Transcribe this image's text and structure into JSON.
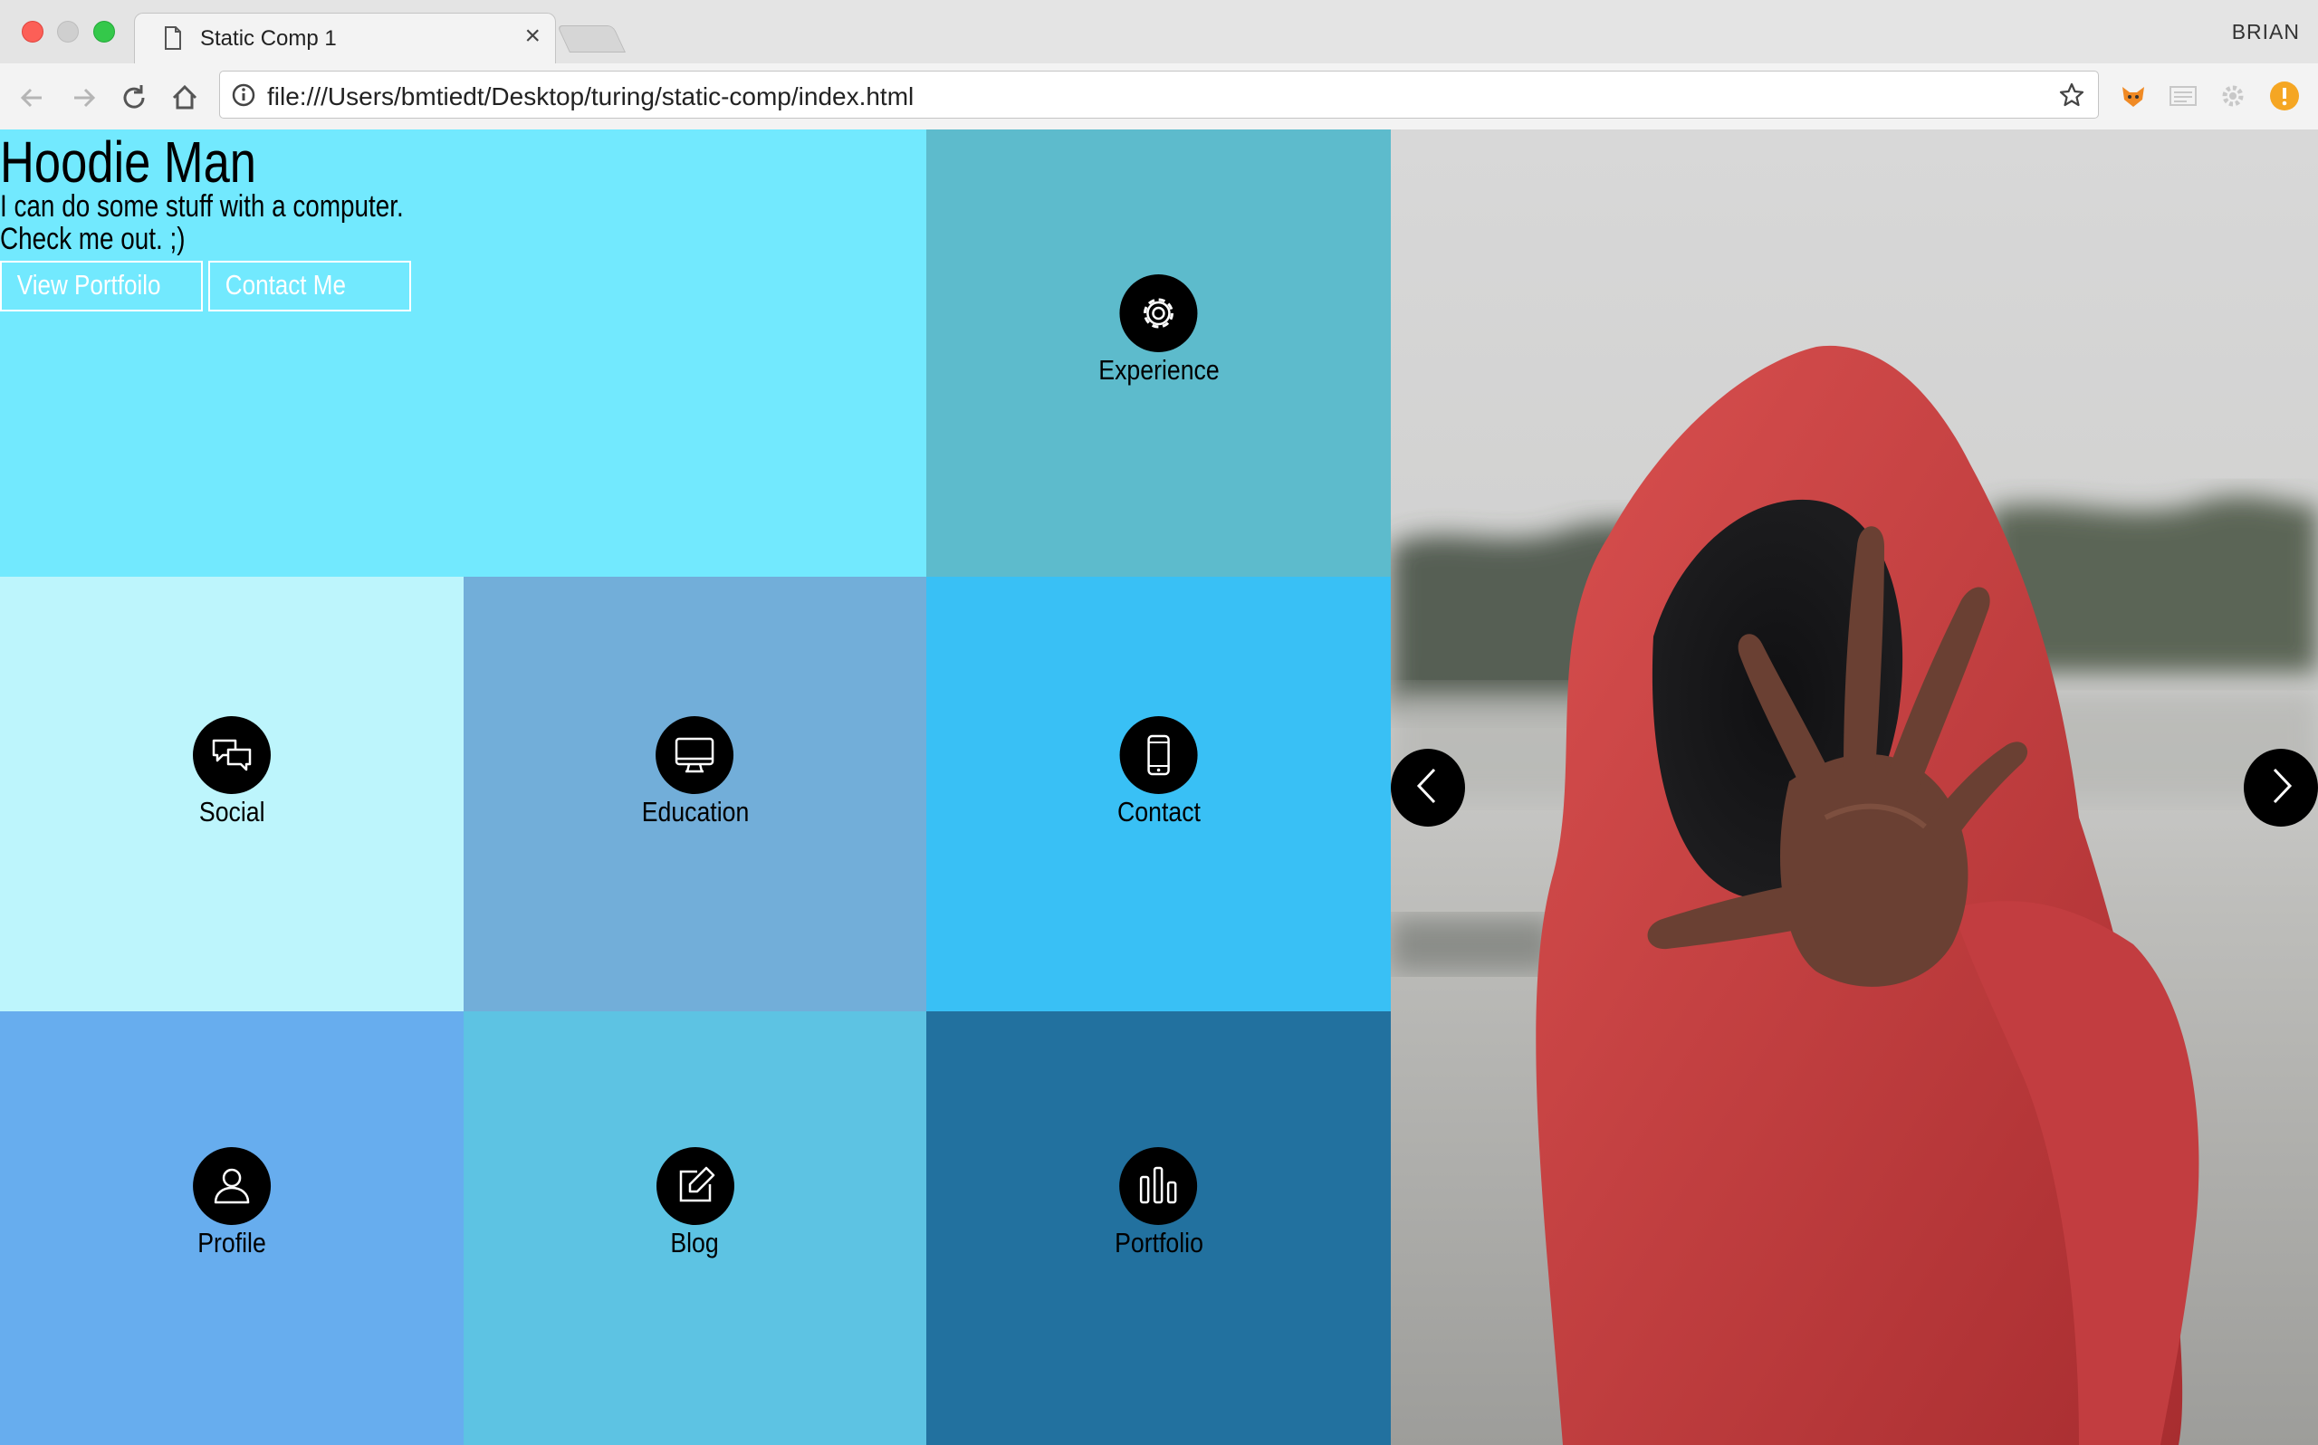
{
  "browser": {
    "tab_title": "Static Comp 1",
    "tab_close": "×",
    "profile_name": "BRIAN",
    "url": "file:///Users/bmtiedt/Desktop/turing/static-comp/index.html"
  },
  "hero": {
    "title": "Hoodie Man",
    "tagline_line1": "I can do some stuff with a computer.",
    "tagline_line2": "Check me out. ;)",
    "buttons": {
      "portfolio": "View Portfoilo",
      "contact": "Contact Me"
    }
  },
  "tiles": {
    "experience": {
      "label": "Experience",
      "icon": "gear-icon",
      "color": "#5dbbcc"
    },
    "social": {
      "label": "Social",
      "icon": "chat-bubbles-icon",
      "color": "#bdf5fc"
    },
    "education": {
      "label": "Education",
      "icon": "monitor-icon",
      "color": "#72aed9"
    },
    "contact": {
      "label": "Contact",
      "icon": "phone-icon",
      "color": "#39c0f5"
    },
    "profile": {
      "label": "Profile",
      "icon": "user-icon",
      "color": "#67adee"
    },
    "blog": {
      "label": "Blog",
      "icon": "edit-icon",
      "color": "#5dc3e3"
    },
    "portfolio": {
      "label": "Portfolio",
      "icon": "bar-chart-icon",
      "color": "#22719f"
    }
  },
  "carousel": {
    "prev_icon": "chevron-left-icon",
    "next_icon": "chevron-right-icon",
    "image": "person in red hoodie reaching toward camera"
  },
  "colors": {
    "hero": "#72e9fe",
    "hoodie": "#c93a3b"
  }
}
